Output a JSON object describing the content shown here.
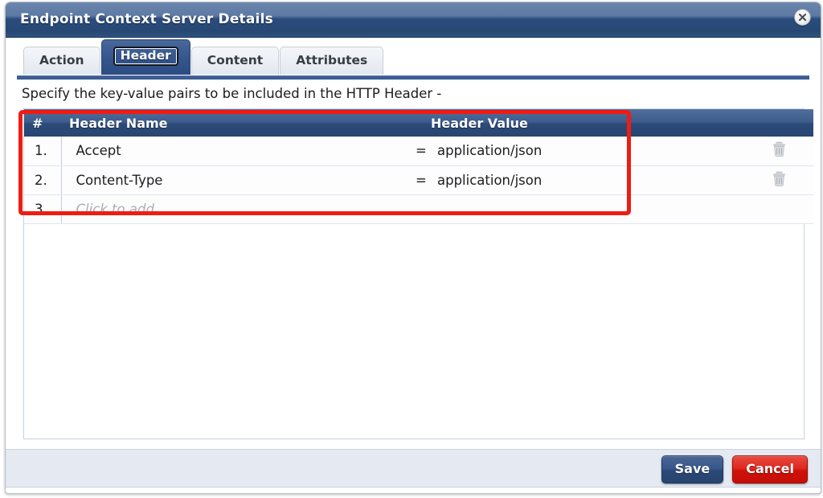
{
  "window": {
    "title": "Endpoint Context Server Details",
    "close_icon": "close-circle-icon"
  },
  "tabs": [
    {
      "label": "Action",
      "active": false
    },
    {
      "label": "Header",
      "active": true
    },
    {
      "label": "Content",
      "active": false
    },
    {
      "label": "Attributes",
      "active": false
    }
  ],
  "content": {
    "hint": "Specify the key-value pairs to be included in the HTTP Header -",
    "table": {
      "columns": {
        "number": "#",
        "name": "Header Name",
        "value": "Header Value"
      },
      "equals_sign": "=",
      "delete_icon": "trash-icon",
      "rows": [
        {
          "number": "1.",
          "name": "Accept",
          "eq": "=",
          "value": "application/json",
          "placeholder": false
        },
        {
          "number": "2.",
          "name": "Content-Type",
          "eq": "=",
          "value": "application/json",
          "placeholder": false
        },
        {
          "number": "3.",
          "name": "Click to add...",
          "eq": "",
          "value": "",
          "placeholder": true
        }
      ]
    }
  },
  "footer": {
    "save_label": "Save",
    "cancel_label": "Cancel"
  },
  "colors": {
    "title_bar": "#2c4d7e",
    "tab_active": "#34558c",
    "table_header": "#2f4f80",
    "save_button": "#2c4c82",
    "cancel_button": "#cf1008",
    "annotation": "#ee1c12",
    "row_number_bg": "#e8ecf4",
    "footer_bg": "#e4e9f2"
  }
}
